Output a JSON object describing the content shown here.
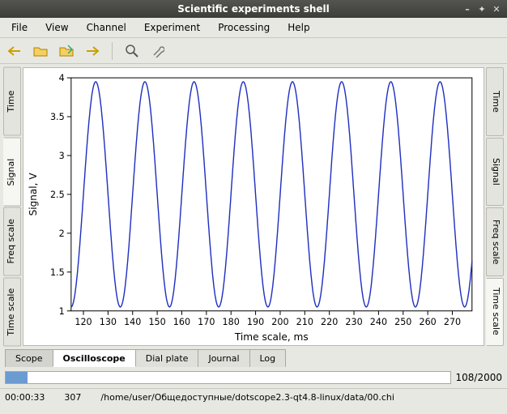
{
  "window": {
    "title": "Scientific experiments shell",
    "min": "–",
    "max": "✦",
    "close": "✕"
  },
  "menu": [
    "File",
    "View",
    "Channel",
    "Experiment",
    "Processing",
    "Help"
  ],
  "side_tabs_left": [
    "Time",
    "Signal",
    "Freq scale",
    "Time scale"
  ],
  "side_tabs_right": [
    "Time",
    "Signal",
    "Freq scale",
    "Time scale"
  ],
  "side_active_left": 1,
  "side_active_right": 3,
  "bottom_tabs": [
    "Scope",
    "Oscilloscope",
    "Dial plate",
    "Journal",
    "Log"
  ],
  "bottom_active": 1,
  "progress": {
    "label": "108/2000"
  },
  "status": {
    "time": "00:00:33",
    "count": "307",
    "path": "/home/user/Общедоступные/dotscope2.3-qt4.8-linux/data/00.chi"
  },
  "chart_data": {
    "type": "line",
    "title": "",
    "xlabel": "Time scale, ms",
    "ylabel": "Signal, V",
    "xlim": [
      115,
      278
    ],
    "ylim": [
      1,
      4
    ],
    "xticks": [
      120,
      130,
      140,
      150,
      160,
      170,
      180,
      190,
      200,
      210,
      220,
      230,
      240,
      250,
      260,
      270
    ],
    "yticks": [
      1,
      1.5,
      2,
      2.5,
      3,
      3.5,
      4
    ],
    "series": [
      {
        "name": "signal",
        "color": "#2030c0",
        "amplitude": 1.45,
        "offset": 2.5,
        "period_ms": 20,
        "phase_ms": 120,
        "x_range": [
          115,
          278
        ]
      }
    ]
  }
}
